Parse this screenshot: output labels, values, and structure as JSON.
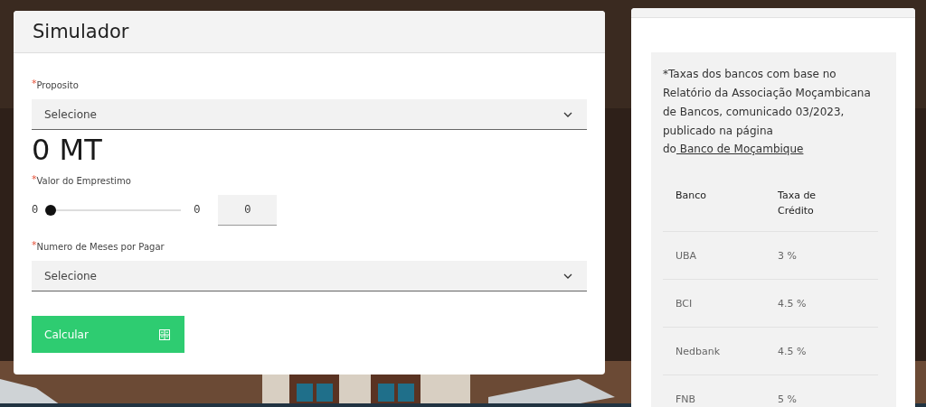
{
  "simulator": {
    "title": "Simulador",
    "purpose": {
      "mark": "*",
      "label": "Proposito",
      "placeholder": "Selecione"
    },
    "amount": "0 MT",
    "loan": {
      "mark": "*",
      "label": "Valor do Emprestimo",
      "min_label": "0",
      "max_label": "0",
      "level": 0,
      "value": "0"
    },
    "months": {
      "mark": "*",
      "label": "Numero de Meses por Pagar",
      "placeholder": "Selecione"
    },
    "button": "Calcular"
  },
  "rates": {
    "note": "*Taxas dos bancos com base no Relatório da Associação Moçambicana de Bancos, comunicado 03/2023, publicado na página do",
    "link": " Banco de Moçambique",
    "columns": [
      "Banco",
      "Taxa de Crédito"
    ],
    "rows": [
      [
        "UBA",
        "3 %"
      ],
      [
        "BCI",
        "4.5 %"
      ],
      [
        "Nedbank",
        "4.5 %"
      ],
      [
        "FNB",
        "5 %"
      ]
    ]
  }
}
